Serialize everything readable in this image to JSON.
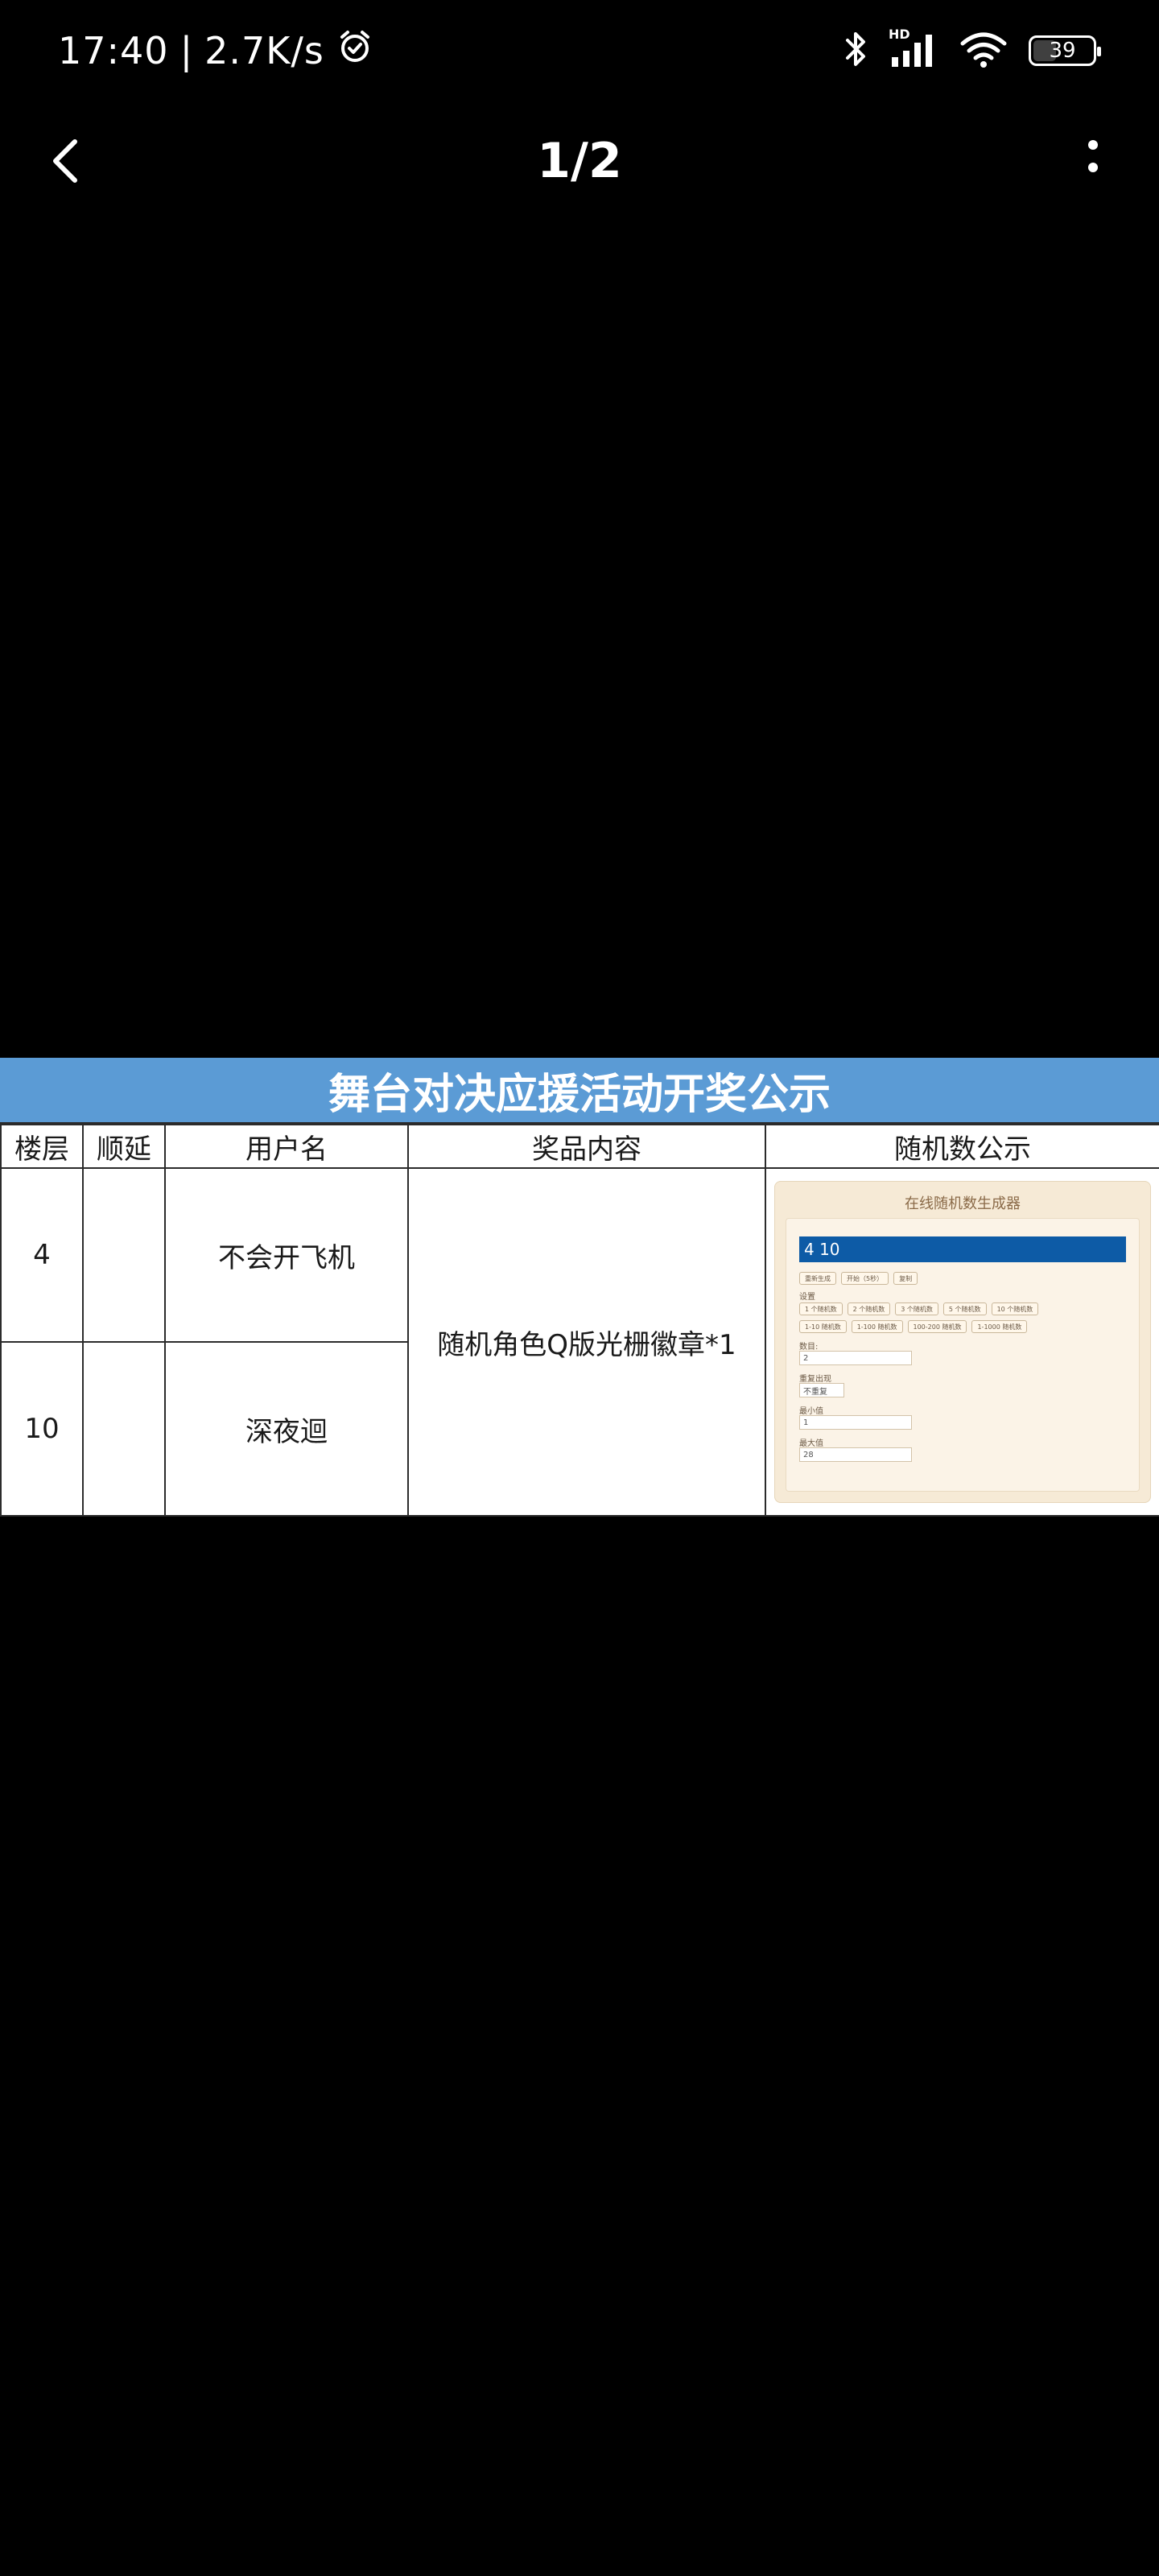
{
  "status_bar": {
    "time": "17:40",
    "network_speed": "2.7K/s",
    "separator": "|",
    "signal_label": "HD",
    "battery": "39",
    "battery_level": 0.39
  },
  "app_bar": {
    "page_counter": "1/2"
  },
  "table": {
    "banner": "舞台对决应援活动开奖公示",
    "headers": [
      "楼层",
      "顺延",
      "用户名",
      "奖品内容",
      "随机数公示"
    ],
    "rows": [
      {
        "floor": "4",
        "deferred": "",
        "username": "不会开飞机"
      },
      {
        "floor": "10",
        "deferred": "",
        "username": "深夜迴"
      }
    ],
    "prize": "随机角色Q版光栅徽章*1"
  },
  "rng_screenshot": {
    "title": "在线随机数生成器",
    "result": "4 10",
    "action_buttons": [
      "重新生成",
      "开始（5秒）",
      "复制"
    ],
    "settings_label": "设置",
    "preset_row1": [
      "1 个随机数",
      "2 个随机数",
      "3 个随机数",
      "5 个随机数",
      "10 个随机数"
    ],
    "preset_row2": [
      "1-10 随机数",
      "1-100 随机数",
      "100-200 随机数",
      "1-1000 随机数"
    ],
    "count_label": "数目:",
    "count_value": "2",
    "repeat_label": "重复出现",
    "repeat_value": "不重复",
    "min_label": "最小值",
    "min_value": "1",
    "max_label": "最大值",
    "max_value": "28"
  }
}
